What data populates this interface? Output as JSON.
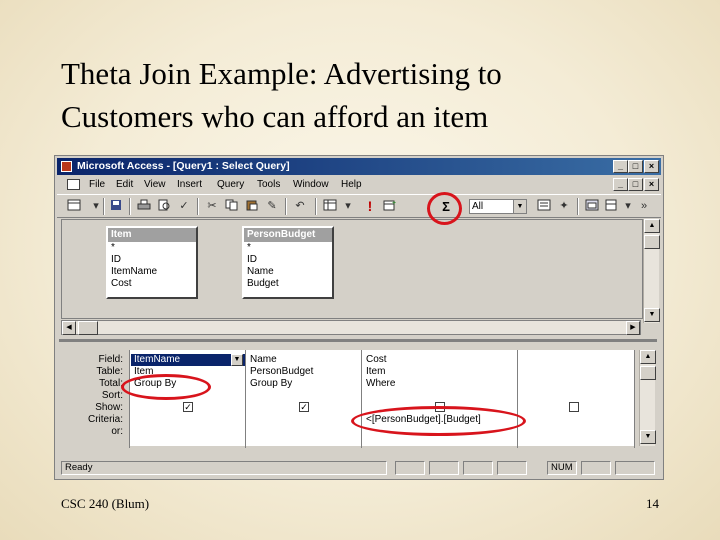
{
  "slide": {
    "title_line1": "Theta Join Example: Advertising to",
    "title_line2": "Customers who can afford an item",
    "footer_left": "CSC 240 (Blum)",
    "footer_right": "14"
  },
  "window": {
    "title": "Microsoft Access - [Query1 : Select Query]",
    "title_buttons": [
      "_",
      "□",
      "×"
    ],
    "doc_buttons": [
      "_",
      "□",
      "×"
    ]
  },
  "menu": [
    "File",
    "Edit",
    "View",
    "Insert",
    "Query",
    "Tools",
    "Window",
    "Help"
  ],
  "toolbar": {
    "icons": [
      "view-icon",
      "save-icon",
      "print-icon",
      "print-preview-icon",
      "spelling-icon",
      "cut-icon",
      "copy-icon",
      "paste-icon",
      "format-painter-icon",
      "undo-icon",
      "query-type-icon",
      "run-icon",
      "show-table-icon",
      "totals-icon",
      "properties-icon",
      "build-icon",
      "database-window-icon",
      "new-object-icon",
      "help-icon"
    ],
    "run_glyph": "!",
    "totals_glyph": "Σ",
    "top_values": "All"
  },
  "tables": [
    {
      "name": "Item",
      "fields": [
        "*",
        "ID",
        "ItemName",
        "Cost"
      ]
    },
    {
      "name": "PersonBudget",
      "fields": [
        "*",
        "ID",
        "Name",
        "Budget"
      ]
    }
  ],
  "grid": {
    "row_labels": [
      "Field:",
      "Table:",
      "Total:",
      "Sort:",
      "Show:",
      "Criteria:",
      "or:"
    ],
    "columns": [
      {
        "field": "ItemName",
        "table": "Item",
        "total": "Group By",
        "sort": "",
        "show": true,
        "criteria": "",
        "or": ""
      },
      {
        "field": "Name",
        "table": "PersonBudget",
        "total": "Group By",
        "sort": "",
        "show": true,
        "criteria": "",
        "or": ""
      },
      {
        "field": "Cost",
        "table": "Item",
        "total": "Where",
        "sort": "",
        "show": false,
        "criteria": "<[PersonBudget].[Budget]",
        "or": ""
      },
      {
        "field": "",
        "table": "",
        "total": "",
        "sort": "",
        "show": false,
        "criteria": "",
        "or": ""
      }
    ],
    "check_glyph": "✓"
  },
  "status": {
    "text": "Ready",
    "num": "NUM"
  },
  "accent_color": "#d8141c"
}
